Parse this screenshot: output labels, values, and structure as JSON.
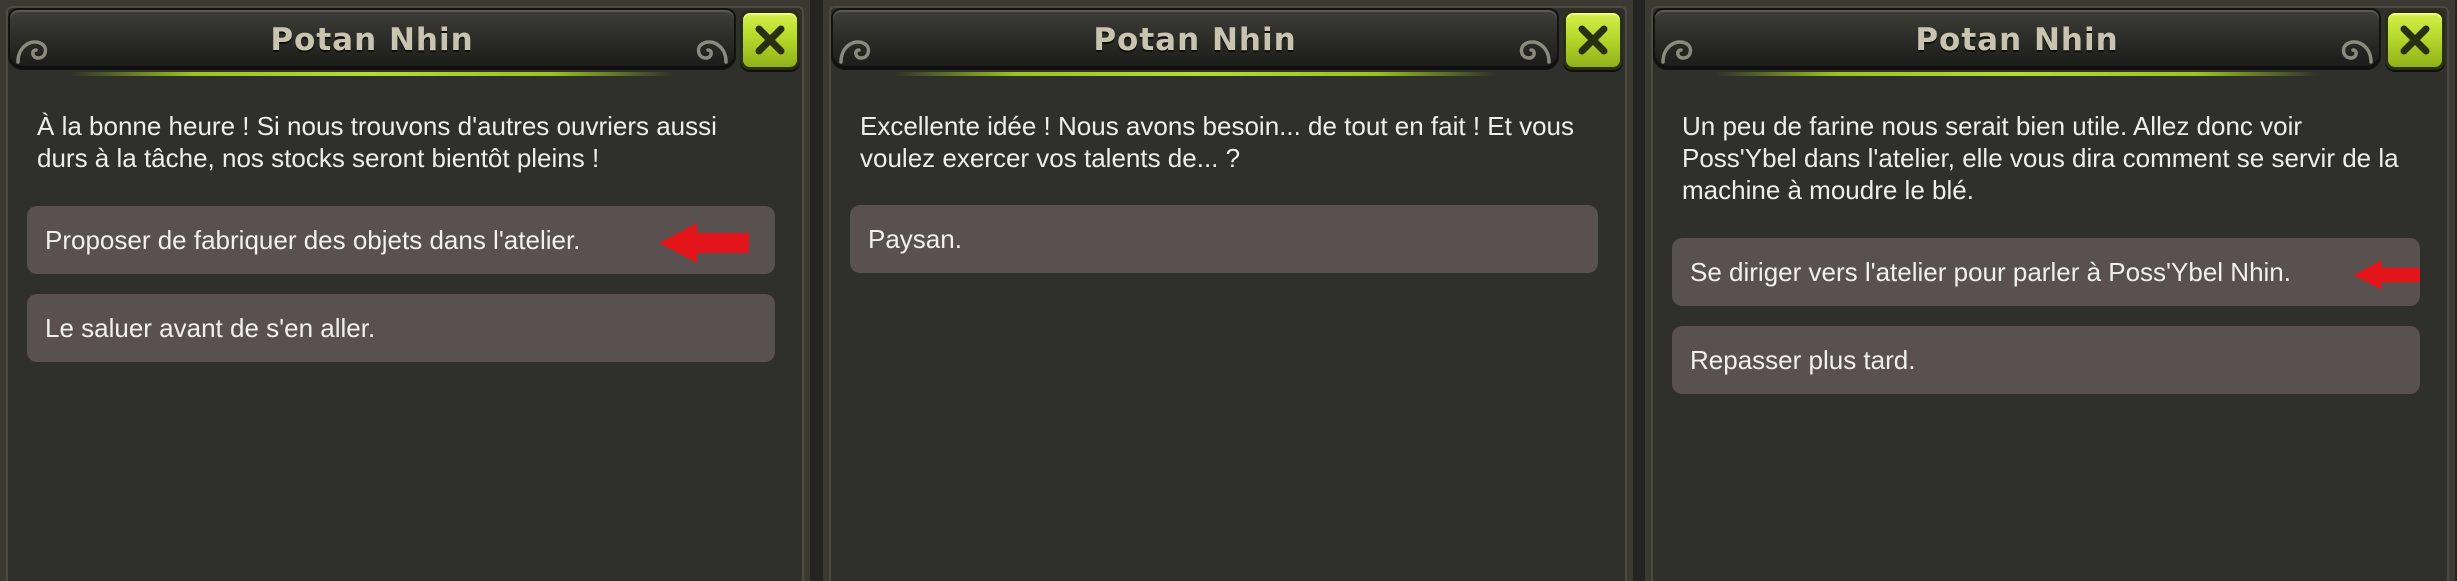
{
  "panels": [
    {
      "title": "Potan Nhin",
      "npc_text": "À la bonne heure ! Si nous trouvons d'autres ouvriers aussi durs à la tâche, nos stocks seront bientôt pleins !",
      "choices": [
        {
          "label": "Proposer de fabriquer des objets dans l'atelier.",
          "highlighted_by_arrow": true
        },
        {
          "label": "Le saluer avant de s'en aller.",
          "highlighted_by_arrow": false
        }
      ]
    },
    {
      "title": "Potan Nhin",
      "npc_text": "Excellente idée ! Nous avons besoin... de tout en fait ! Et vous voulez exercer vos talents de... ?",
      "choices": [
        {
          "label": "Paysan.",
          "highlighted_by_arrow": false
        }
      ]
    },
    {
      "title": "Potan Nhin",
      "npc_text": "Un peu de farine nous serait bien utile. Allez donc voir Poss'Ybel dans l'atelier, elle vous dira comment se servir de la machine à moudre le blé.",
      "choices": [
        {
          "label": "Se diriger vers l'atelier pour parler à Poss'Ybel Nhin.",
          "highlighted_by_arrow": true
        },
        {
          "label": "Repasser plus tard.",
          "highlighted_by_arrow": false
        }
      ]
    }
  ],
  "icons": {
    "close": "close-icon",
    "arrow": "red-arrow-left-icon",
    "ornament": "swirl-ornament-icon"
  },
  "colors": {
    "accent_green": "#b7d92b",
    "choice_bg": "#58514f",
    "panel_bg": "#2f2f2b",
    "arrow_red": "#e3151b",
    "title_text": "#c9c4b0"
  }
}
